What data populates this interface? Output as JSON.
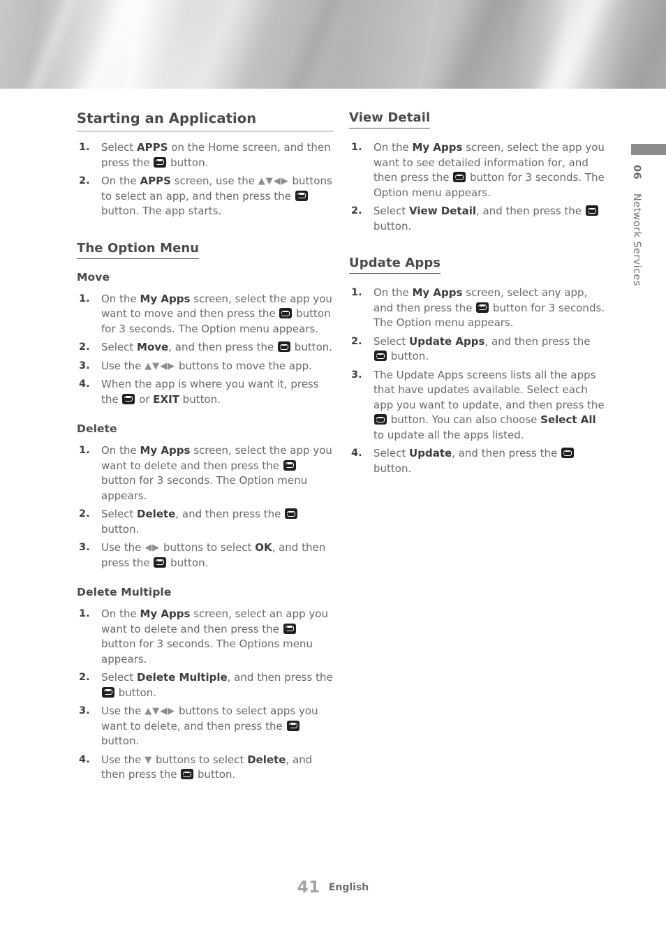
{
  "document": {
    "page_number": "41",
    "language": "English"
  },
  "side_tab": {
    "chapter_number": "06",
    "chapter_title": "Network Services"
  },
  "icons": {
    "enter_button": "enter-button-icon",
    "arrows_four": "▲▼◀▶",
    "arrows_lr": "◀▶",
    "arrow_down": "▼"
  },
  "left_column": {
    "section_title": "Starting an Application",
    "starting_steps": [
      {
        "parts": [
          {
            "t": "text",
            "v": "Select "
          },
          {
            "t": "bold",
            "v": "APPS"
          },
          {
            "t": "text",
            "v": " on the Home screen, and then press the "
          },
          {
            "t": "enter"
          },
          {
            "t": "text",
            "v": " button."
          }
        ]
      },
      {
        "parts": [
          {
            "t": "text",
            "v": "On the "
          },
          {
            "t": "bold",
            "v": "APPS"
          },
          {
            "t": "text",
            "v": " screen, use the "
          },
          {
            "t": "arrows",
            "v": "▲▼◀▶"
          },
          {
            "t": "text",
            "v": " buttons to select an app, and then press the "
          },
          {
            "t": "enter"
          },
          {
            "t": "text",
            "v": " button. The app starts."
          }
        ]
      }
    ],
    "option_menu_title": "The Option Menu",
    "move_title": "Move",
    "move_steps": [
      {
        "parts": [
          {
            "t": "text",
            "v": "On the "
          },
          {
            "t": "bold",
            "v": "My Apps"
          },
          {
            "t": "text",
            "v": " screen, select the app you want to move and then press the "
          },
          {
            "t": "enter"
          },
          {
            "t": "text",
            "v": " button for 3 seconds. The Option menu appears."
          }
        ]
      },
      {
        "parts": [
          {
            "t": "text",
            "v": "Select "
          },
          {
            "t": "bold",
            "v": "Move"
          },
          {
            "t": "text",
            "v": ", and then press the "
          },
          {
            "t": "enter"
          },
          {
            "t": "text",
            "v": " button."
          }
        ]
      },
      {
        "parts": [
          {
            "t": "text",
            "v": "Use the "
          },
          {
            "t": "arrows",
            "v": "▲▼◀▶"
          },
          {
            "t": "text",
            "v": " buttons to move the app."
          }
        ]
      },
      {
        "parts": [
          {
            "t": "text",
            "v": "When the app is where you want it, press the "
          },
          {
            "t": "enter"
          },
          {
            "t": "text",
            "v": " or "
          },
          {
            "t": "bold",
            "v": "EXIT"
          },
          {
            "t": "text",
            "v": " button."
          }
        ]
      }
    ],
    "delete_title": "Delete",
    "delete_steps": [
      {
        "parts": [
          {
            "t": "text",
            "v": "On the "
          },
          {
            "t": "bold",
            "v": "My Apps"
          },
          {
            "t": "text",
            "v": " screen, select the app you want to delete and then press the "
          },
          {
            "t": "enter"
          },
          {
            "t": "text",
            "v": " button for 3 seconds. The Option menu appears."
          }
        ]
      },
      {
        "parts": [
          {
            "t": "text",
            "v": "Select "
          },
          {
            "t": "bold",
            "v": "Delete"
          },
          {
            "t": "text",
            "v": ", and then press the "
          },
          {
            "t": "enter"
          },
          {
            "t": "text",
            "v": " button."
          }
        ]
      },
      {
        "parts": [
          {
            "t": "text",
            "v": "Use the "
          },
          {
            "t": "arrows",
            "v": "◀▶"
          },
          {
            "t": "text",
            "v": " buttons to select "
          },
          {
            "t": "bold",
            "v": "OK"
          },
          {
            "t": "text",
            "v": ", and then press the "
          },
          {
            "t": "enter"
          },
          {
            "t": "text",
            "v": " button."
          }
        ]
      }
    ],
    "delete_multiple_title": "Delete Multiple",
    "delete_multiple_steps": [
      {
        "parts": [
          {
            "t": "text",
            "v": "On the "
          },
          {
            "t": "bold",
            "v": "My Apps"
          },
          {
            "t": "text",
            "v": " screen, select an app you want to delete and then press the "
          },
          {
            "t": "enter"
          },
          {
            "t": "text",
            "v": " button for 3 seconds. The Options menu appears."
          }
        ]
      },
      {
        "parts": [
          {
            "t": "text",
            "v": "Select "
          },
          {
            "t": "bold",
            "v": "Delete Multiple"
          },
          {
            "t": "text",
            "v": ", and then press the "
          },
          {
            "t": "enter"
          },
          {
            "t": "text",
            "v": " button."
          }
        ]
      },
      {
        "parts": [
          {
            "t": "text",
            "v": "Use the "
          },
          {
            "t": "arrows",
            "v": "▲▼◀▶"
          },
          {
            "t": "text",
            "v": " buttons to select apps you want to delete, and then press the "
          },
          {
            "t": "enter"
          },
          {
            "t": "text",
            "v": " button."
          }
        ]
      },
      {
        "parts": [
          {
            "t": "text",
            "v": "Use the "
          },
          {
            "t": "arrows",
            "v": "▼"
          },
          {
            "t": "text",
            "v": " buttons to select "
          },
          {
            "t": "bold",
            "v": "Delete"
          },
          {
            "t": "text",
            "v": ", and then press the "
          },
          {
            "t": "enter"
          },
          {
            "t": "text",
            "v": " button."
          }
        ]
      }
    ]
  },
  "right_column": {
    "view_detail_title": "View Detail",
    "view_detail_steps": [
      {
        "parts": [
          {
            "t": "text",
            "v": "On the "
          },
          {
            "t": "bold",
            "v": "My Apps"
          },
          {
            "t": "text",
            "v": " screen, select the app you want to see detailed information for, and then press the "
          },
          {
            "t": "enter"
          },
          {
            "t": "text",
            "v": " button for 3 seconds. The Option menu appears."
          }
        ]
      },
      {
        "parts": [
          {
            "t": "text",
            "v": "Select "
          },
          {
            "t": "bold",
            "v": "View Detail"
          },
          {
            "t": "text",
            "v": ", and then press the "
          },
          {
            "t": "enter"
          },
          {
            "t": "text",
            "v": " button."
          }
        ]
      }
    ],
    "update_apps_title": "Update Apps",
    "update_apps_steps": [
      {
        "parts": [
          {
            "t": "text",
            "v": "On the "
          },
          {
            "t": "bold",
            "v": "My Apps"
          },
          {
            "t": "text",
            "v": " screen, select any app, and then press the "
          },
          {
            "t": "enter"
          },
          {
            "t": "text",
            "v": " button for 3 seconds. The Option menu appears."
          }
        ]
      },
      {
        "parts": [
          {
            "t": "text",
            "v": "Select "
          },
          {
            "t": "bold",
            "v": "Update Apps"
          },
          {
            "t": "text",
            "v": ", and then press the "
          },
          {
            "t": "enter"
          },
          {
            "t": "text",
            "v": " button."
          }
        ]
      },
      {
        "parts": [
          {
            "t": "text",
            "v": "The Update Apps screens lists all the apps that have updates available. Select each app you want to update, and then press the "
          },
          {
            "t": "enter"
          },
          {
            "t": "text",
            "v": " button. You can also choose "
          },
          {
            "t": "bold",
            "v": "Select All"
          },
          {
            "t": "text",
            "v": " to update all the apps listed."
          }
        ]
      },
      {
        "parts": [
          {
            "t": "text",
            "v": "Select "
          },
          {
            "t": "bold",
            "v": "Update"
          },
          {
            "t": "text",
            "v": ", and then press the "
          },
          {
            "t": "enter"
          },
          {
            "t": "text",
            "v": " button."
          }
        ]
      }
    ]
  },
  "colors": {
    "heading": "#4a4a4a",
    "body_text": "#6a6a6a",
    "bold_text": "#3d3d3d",
    "rule_light": "#d2d2d2",
    "rule_dark": "#545454",
    "side_tab_bar": "#8c8c8c",
    "page_number": "#a3a3a3",
    "icon_background": "#1f1f1f"
  }
}
